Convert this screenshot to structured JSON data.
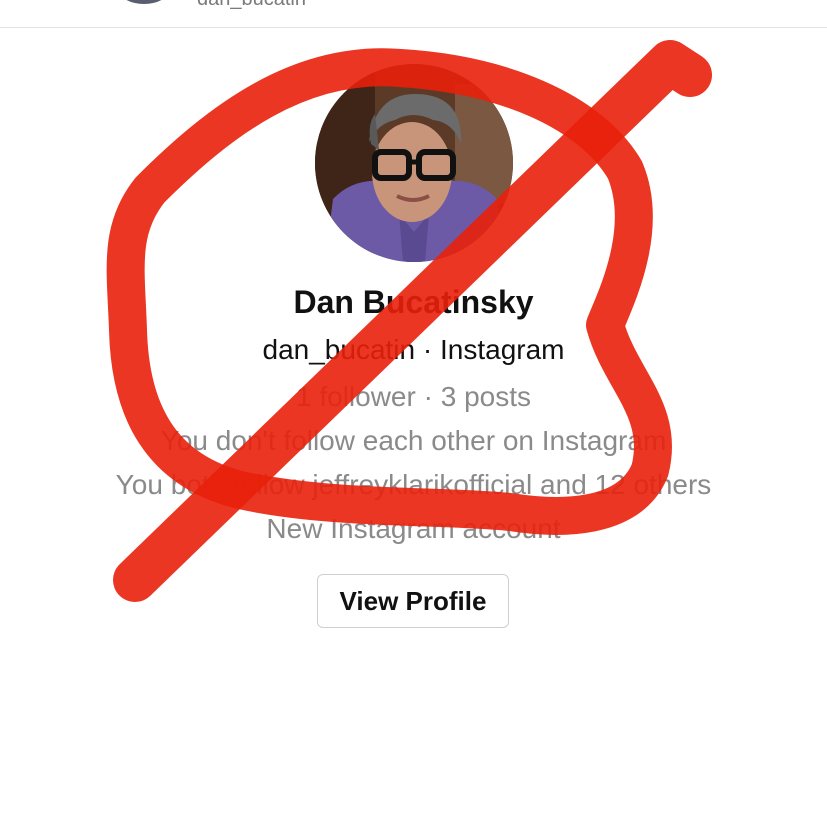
{
  "header": {
    "username": "dan_bucatin"
  },
  "profile": {
    "name": "Dan Bucatinsky",
    "handle": "dan_bucatin",
    "separator": "·",
    "platform": "Instagram",
    "followers": "1 follower",
    "posts": "3 posts",
    "follow_status": "You don't follow each other on Instagram",
    "mutuals": "You both follow jeffreyklarikofficial and 12 others",
    "account_note": "New Instagram account"
  },
  "actions": {
    "view_profile_label": "View Profile"
  },
  "colors": {
    "scribble": "#e8200a",
    "muted_text": "#8a8a8a",
    "primary_text": "#111111"
  }
}
